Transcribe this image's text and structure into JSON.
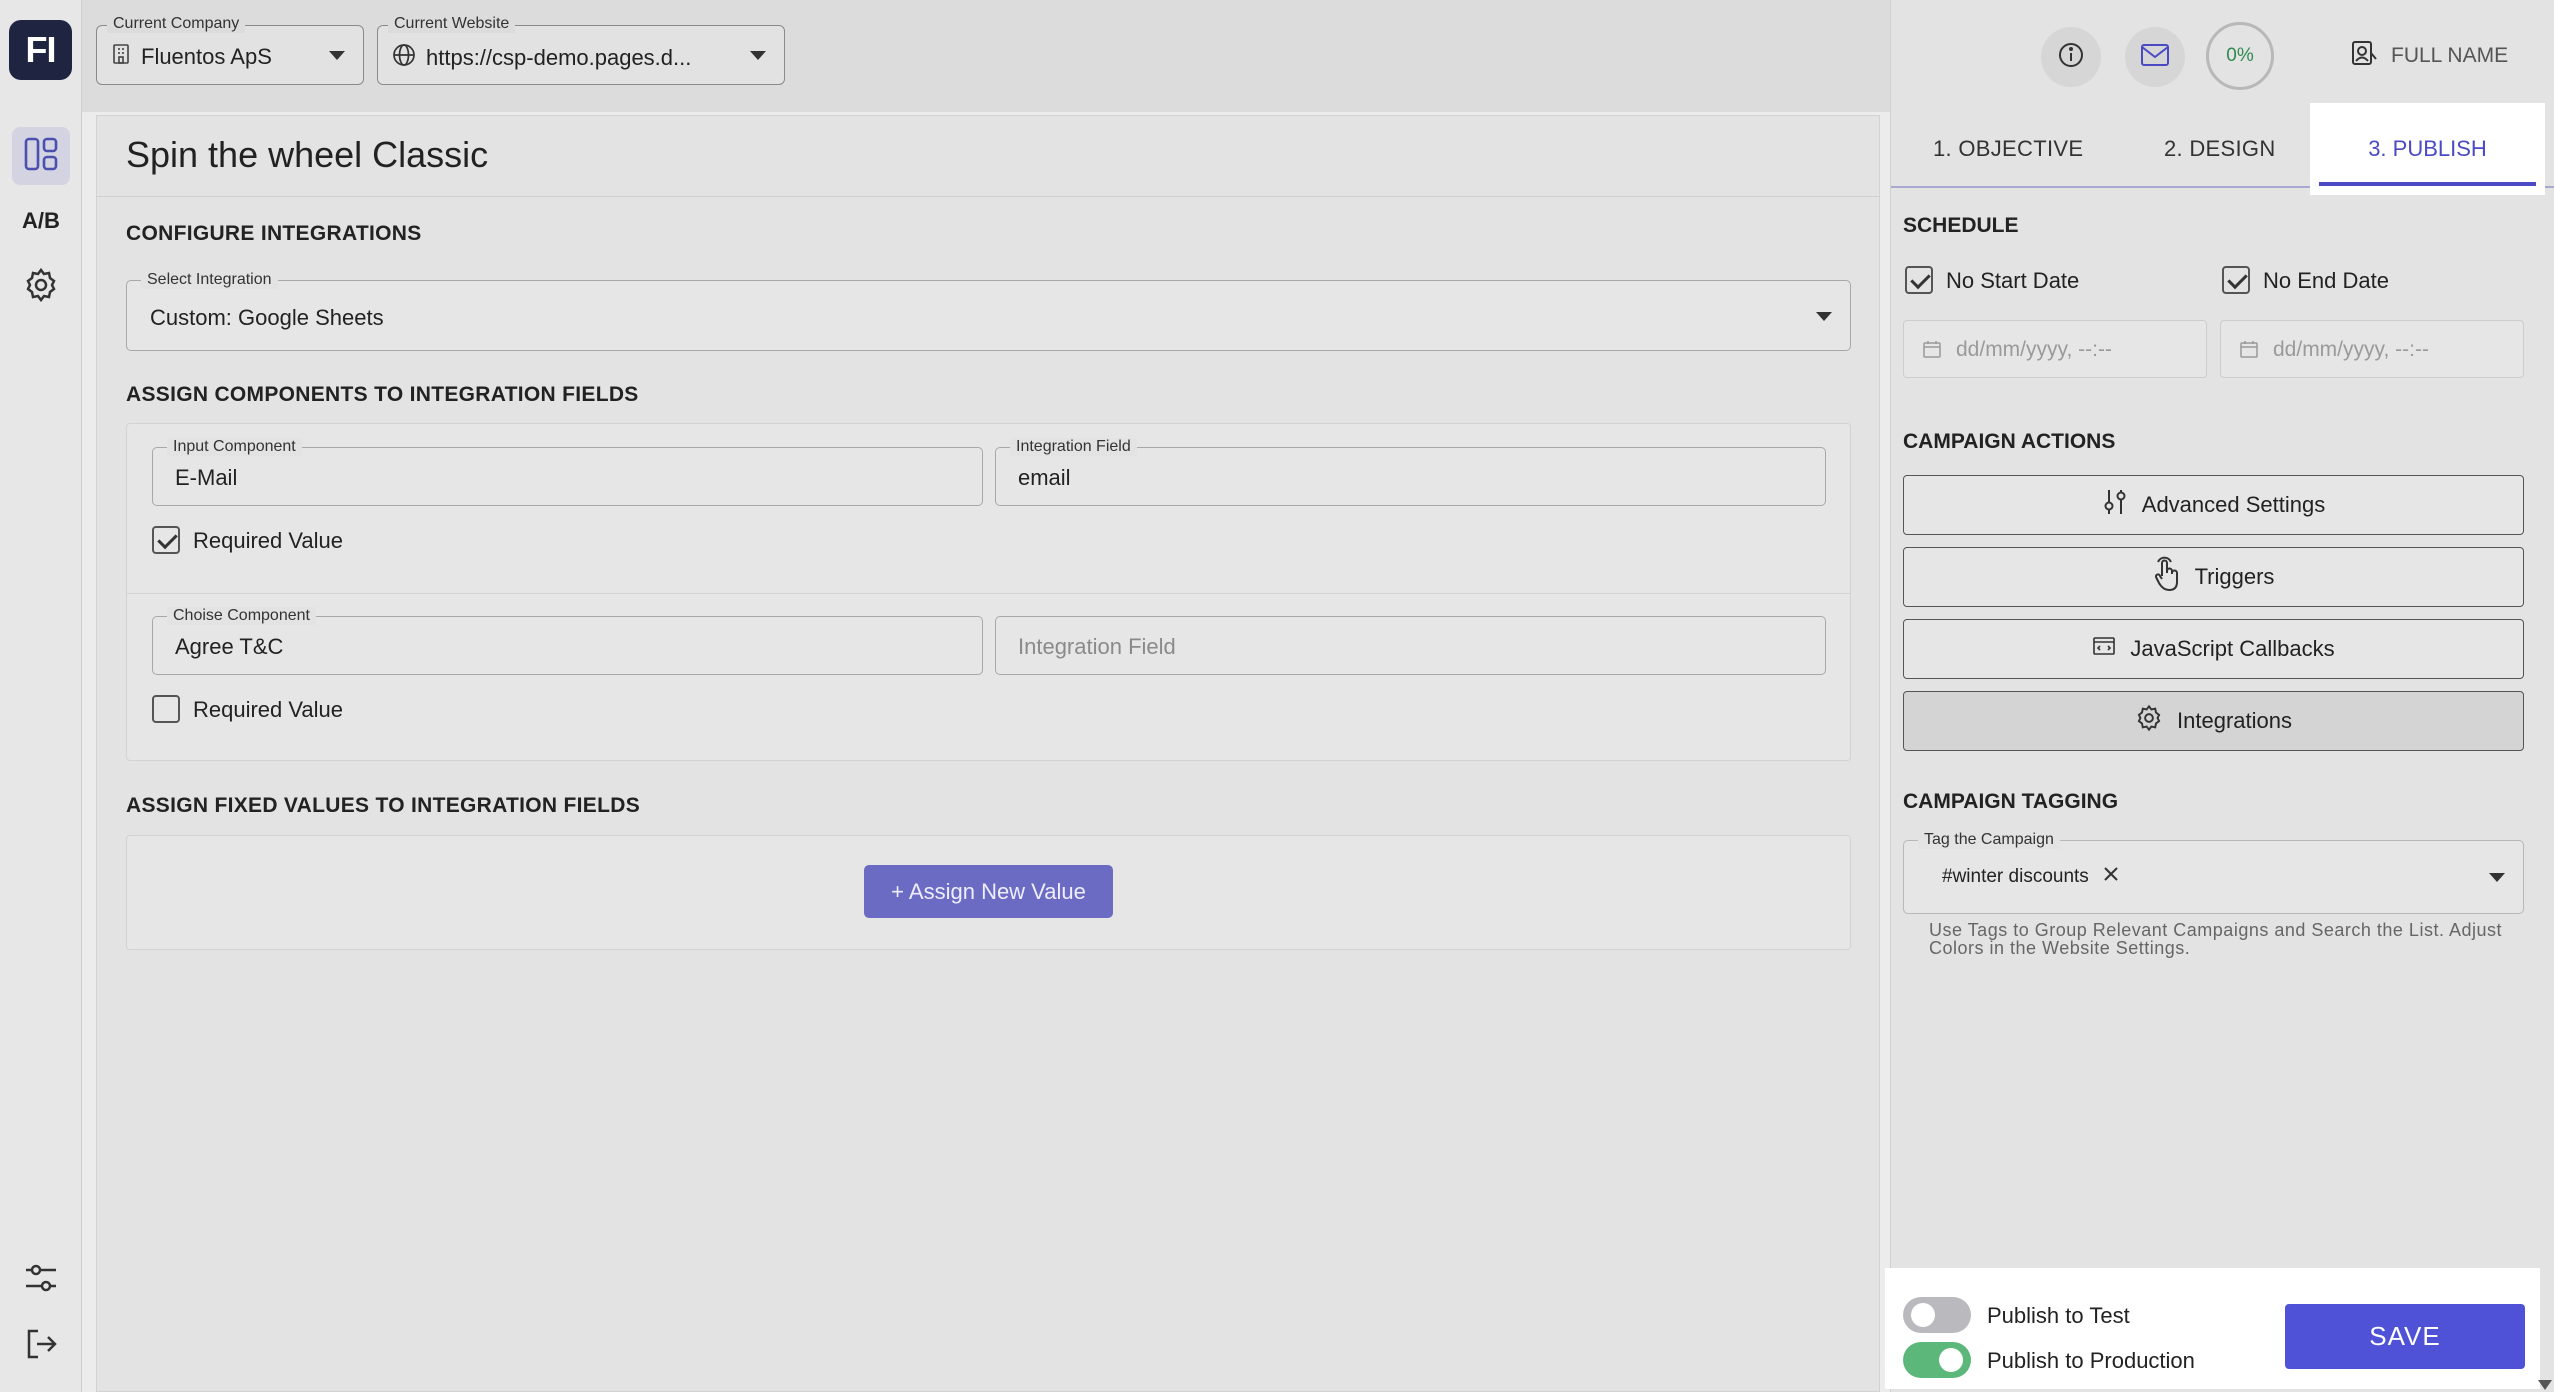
{
  "logo": {
    "text": "FI"
  },
  "rail": {
    "items": [
      {
        "icon": "dashboard-icon"
      },
      {
        "label": "A/B"
      },
      {
        "icon": "gear-icon"
      }
    ],
    "bottom": [
      {
        "icon": "sliders-icon"
      },
      {
        "icon": "logout-icon"
      }
    ]
  },
  "topbar": {
    "company": {
      "legend": "Current Company",
      "value": "Fluentos ApS"
    },
    "website": {
      "legend": "Current Website",
      "value": "https://csp-demo.pages.d..."
    }
  },
  "main": {
    "title": "Spin the wheel Classic",
    "configure": {
      "heading": "CONFIGURE INTEGRATIONS",
      "select_legend": "Select Integration",
      "select_value": "Custom: Google Sheets"
    },
    "assign": {
      "heading": "ASSIGN COMPONENTS TO INTEGRATION FIELDS",
      "rows": [
        {
          "comp_legend": "Input Component",
          "comp_value": "E-Mail",
          "field_legend": "Integration Field",
          "field_value": "email",
          "required_label": "Required Value",
          "required": true
        },
        {
          "comp_legend": "Choise Component",
          "comp_value": "Agree T&C",
          "field_placeholder": "Integration Field",
          "required_label": "Required Value",
          "required": false
        }
      ]
    },
    "fixed": {
      "heading": "ASSIGN FIXED VALUES TO INTEGRATION FIELDS",
      "button": "+ Assign New Value"
    }
  },
  "right": {
    "progress": "0%",
    "user": "FULL NAME",
    "tabs": [
      "1. OBJECTIVE",
      "2. DESIGN",
      "3. PUBLISH"
    ],
    "schedule": {
      "heading": "SCHEDULE",
      "no_start": "No Start Date",
      "no_end": "No End Date",
      "date_placeholder": "dd/mm/yyyy, --:--"
    },
    "actions": {
      "heading": "CAMPAIGN ACTIONS",
      "buttons": [
        "Advanced Settings",
        "Triggers",
        "JavaScript Callbacks",
        "Integrations"
      ]
    },
    "tagging": {
      "heading": "CAMPAIGN TAGGING",
      "legend": "Tag the Campaign",
      "tag": "#winter discounts",
      "hint": "Use Tags to Group Relevant Campaigns and Search the List. Adjust Colors in the Website Settings."
    },
    "publish": {
      "test_label": "Publish to Test",
      "prod_label": "Publish to Production",
      "save": "SAVE"
    }
  }
}
